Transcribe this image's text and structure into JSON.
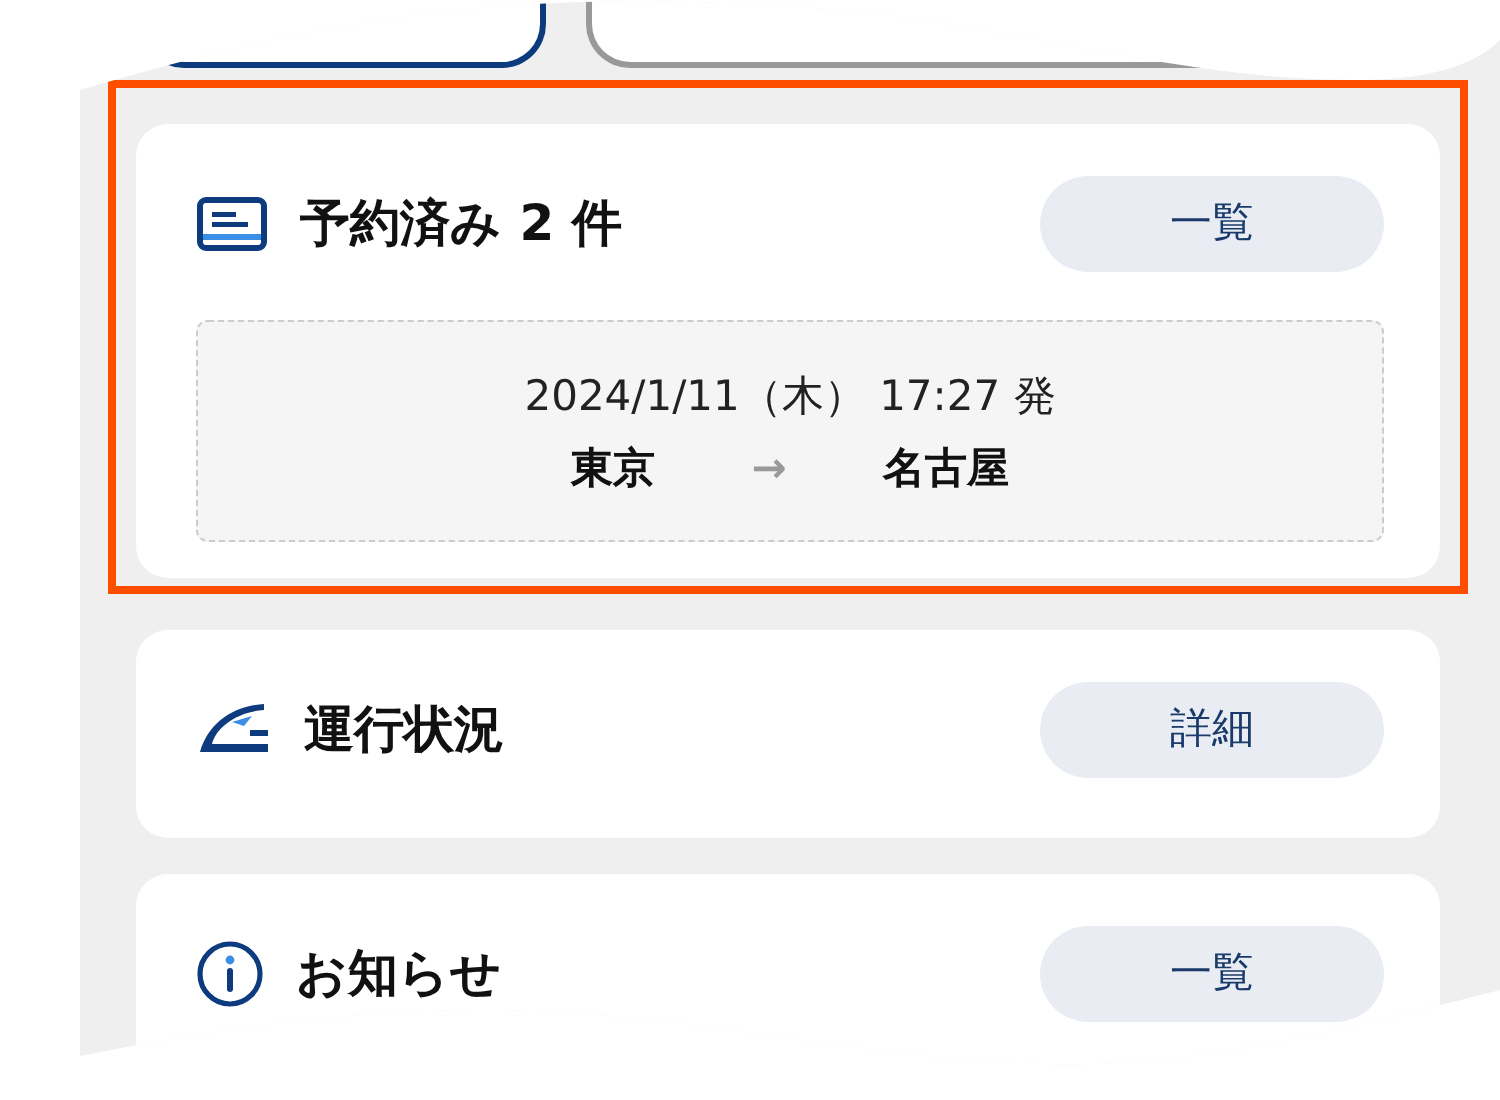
{
  "tabs": [
    {
      "selected": true
    },
    {
      "selected": false
    }
  ],
  "cards": [
    {
      "kind": "reservations",
      "title": "予約済み 2 件",
      "button": "一覧",
      "highlighted": true,
      "reservation": {
        "departure": "2024/1/11（木） 17:27 発",
        "from": "東京",
        "arrow": "→",
        "to": "名古屋"
      }
    },
    {
      "kind": "status",
      "title": "運行状況",
      "button": "詳細",
      "highlighted": false
    },
    {
      "kind": "news",
      "title": "お知らせ",
      "button": "一覧",
      "highlighted": false
    }
  ]
}
